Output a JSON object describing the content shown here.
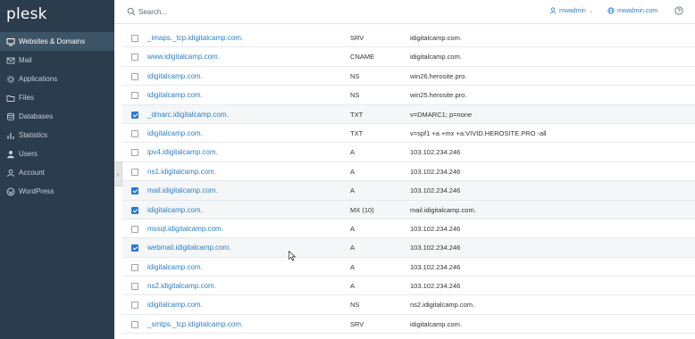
{
  "brand": {
    "logo": "plesk"
  },
  "nav": {
    "items": [
      {
        "label": "Websites & Domains",
        "icon": "monitor-icon",
        "active": true
      },
      {
        "label": "Mail",
        "icon": "mail-icon"
      },
      {
        "label": "Applications",
        "icon": "gear-icon"
      },
      {
        "label": "Files",
        "icon": "folder-icon"
      },
      {
        "label": "Databases",
        "icon": "database-icon"
      },
      {
        "label": "Statistics",
        "icon": "bar-chart-icon"
      },
      {
        "label": "Users",
        "icon": "user-icon"
      },
      {
        "label": "Account",
        "icon": "account-icon"
      },
      {
        "label": "WordPress",
        "icon": "wordpress-icon"
      }
    ]
  },
  "topbar": {
    "search_placeholder": "Search...",
    "user_label": "mwadmin",
    "subscription_label": "mwadmin.com",
    "help_icon": "help-icon"
  },
  "collapse_glyph": "‹",
  "records": [
    {
      "host": "_imaps._tcp.idigitalcamp.com.",
      "type": "SRV",
      "value": "idigitalcamp.com.",
      "checked": false
    },
    {
      "host": "www.idigitalcamp.com.",
      "type": "CNAME",
      "value": "idigitalcamp.com.",
      "checked": false
    },
    {
      "host": "idigitalcamp.com.",
      "type": "NS",
      "value": "win26.herosite.pro.",
      "checked": false
    },
    {
      "host": "idigitalcamp.com.",
      "type": "NS",
      "value": "win25.herosite.pro.",
      "checked": false
    },
    {
      "host": "_dmarc.idigitalcamp.com.",
      "type": "TXT",
      "value": "v=DMARC1; p=none",
      "checked": true
    },
    {
      "host": "idigitalcamp.com.",
      "type": "TXT",
      "value": "v=spf1 +a +mx +a:VIVID.HEROSITE.PRO -all",
      "checked": false
    },
    {
      "host": "ipv4.idigitalcamp.com.",
      "type": "A",
      "value": "103.102.234.246",
      "checked": false
    },
    {
      "host": "ns1.idigitalcamp.com.",
      "type": "A",
      "value": "103.102.234.246",
      "checked": false
    },
    {
      "host": "mail.idigitalcamp.com.",
      "type": "A",
      "value": "103.102.234.246",
      "checked": true
    },
    {
      "host": "idigitalcamp.com.",
      "type": "MX (10)",
      "value": "mail.idigitalcamp.com.",
      "checked": true
    },
    {
      "host": "mssql.idigitalcamp.com.",
      "type": "A",
      "value": "103.102.234.246",
      "checked": false
    },
    {
      "host": "webmail.idigitalcamp.com.",
      "type": "A",
      "value": "103.102.234.246",
      "checked": true
    },
    {
      "host": "idigitalcamp.com.",
      "type": "A",
      "value": "103.102.234.246",
      "checked": false
    },
    {
      "host": "ns2.idigitalcamp.com.",
      "type": "A",
      "value": "103.102.234.246",
      "checked": false
    },
    {
      "host": "idigitalcamp.com.",
      "type": "NS",
      "value": "ns2.idigitalcamp.com.",
      "checked": false
    },
    {
      "host": "_smtps._tcp.idigitalcamp.com.",
      "type": "SRV",
      "value": "idigitalcamp.com.",
      "checked": false
    }
  ],
  "colors": {
    "sidebar_bg": "#2b3c4d",
    "active_nav_bg": "#3d5366",
    "link": "#2f80c2",
    "checkbox_checked": "#2a7ad6"
  }
}
